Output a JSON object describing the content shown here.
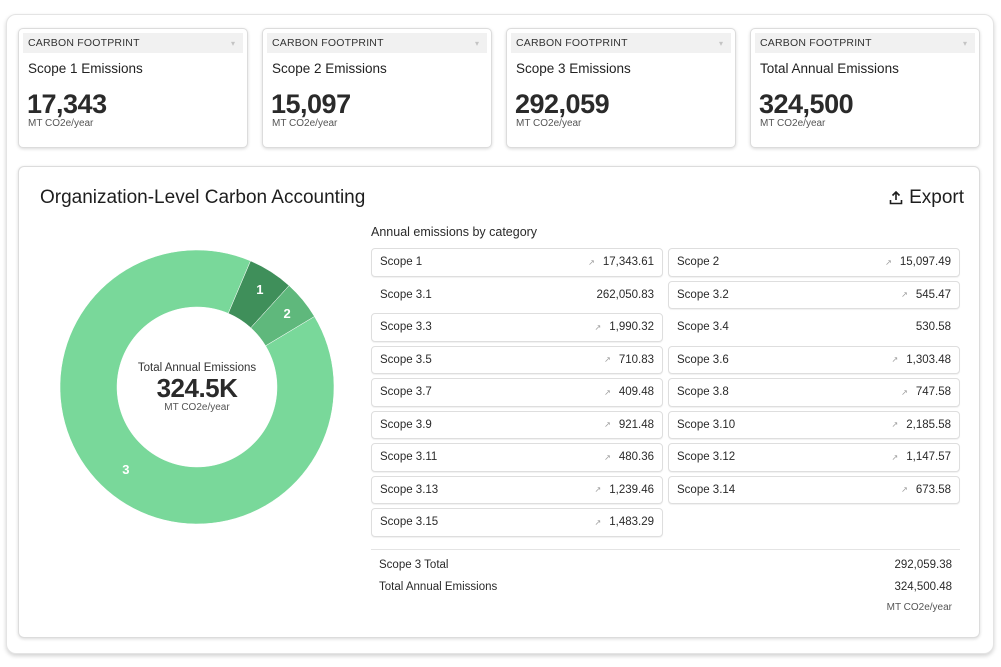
{
  "kpis": [
    {
      "header": "CARBON FOOTPRINT",
      "title": "Scope 1 Emissions",
      "value": "17,343",
      "unit": "MT CO2e/year"
    },
    {
      "header": "CARBON FOOTPRINT",
      "title": "Scope 2 Emissions",
      "value": "15,097",
      "unit": "MT CO2e/year"
    },
    {
      "header": "CARBON FOOTPRINT",
      "title": "Scope 3 Emissions",
      "value": "292,059",
      "unit": "MT CO2e/year"
    },
    {
      "header": "CARBON FOOTPRINT",
      "title": "Total Annual Emissions",
      "value": "324,500",
      "unit": "MT CO2e/year"
    }
  ],
  "icons": {
    "kpi_caret": "▾",
    "trend": "↗"
  },
  "panel": {
    "title": "Organization-Level Carbon Accounting",
    "export_label": "Export",
    "category_title": "Annual emissions by category",
    "categories": [
      {
        "label": "Scope 1",
        "value": "17,343.61",
        "trend": true
      },
      {
        "label": "Scope 2",
        "value": "15,097.49",
        "trend": true
      },
      {
        "label": "Scope 3.1",
        "value": "262,050.83",
        "trend": false
      },
      {
        "label": "Scope 3.2",
        "value": "545.47",
        "trend": true
      },
      {
        "label": "Scope 3.3",
        "value": "1,990.32",
        "trend": true
      },
      {
        "label": "Scope 3.4",
        "value": "530.58",
        "trend": false
      },
      {
        "label": "Scope 3.5",
        "value": "710.83",
        "trend": true
      },
      {
        "label": "Scope 3.6",
        "value": "1,303.48",
        "trend": true
      },
      {
        "label": "Scope 3.7",
        "value": "409.48",
        "trend": true
      },
      {
        "label": "Scope 3.8",
        "value": "747.58",
        "trend": true
      },
      {
        "label": "Scope 3.9",
        "value": "921.48",
        "trend": true
      },
      {
        "label": "Scope 3.10",
        "value": "2,185.58",
        "trend": true
      },
      {
        "label": "Scope 3.11",
        "value": "480.36",
        "trend": true
      },
      {
        "label": "Scope 3.12",
        "value": "1,147.57",
        "trend": true
      },
      {
        "label": "Scope 3.13",
        "value": "1,239.46",
        "trend": true
      },
      {
        "label": "Scope 3.14",
        "value": "673.58",
        "trend": true
      },
      {
        "label": "Scope 3.15",
        "value": "1,483.29",
        "trend": true
      }
    ],
    "totals": [
      {
        "label": "Scope 3 Total",
        "value": "292,059.38"
      },
      {
        "label": "Total Annual Emissions",
        "value": "324,500.48"
      }
    ],
    "totals_unit": "MT CO2e/year"
  },
  "chart_data": {
    "type": "pie",
    "variant": "donut",
    "title": "",
    "center_label": "Total Annual Emissions",
    "center_value": "324.5K",
    "center_unit": "MT CO2e/year",
    "slices": [
      {
        "label": "3",
        "name": "Scope 3",
        "value": 292059.38,
        "color": "#79d89a"
      },
      {
        "label": "1",
        "name": "Scope 1",
        "value": 17343.61,
        "color": "#3f8f5a"
      },
      {
        "label": "2",
        "name": "Scope 2",
        "value": 15097.49,
        "color": "#5fb87c"
      }
    ],
    "legend": "none"
  }
}
